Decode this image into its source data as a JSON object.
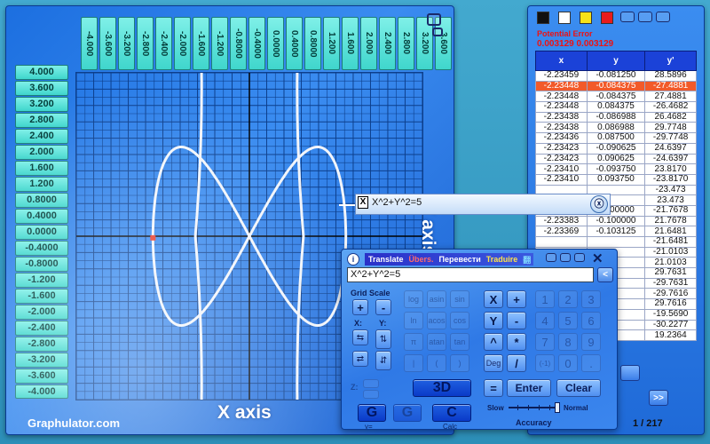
{
  "graph": {
    "x_ticks": [
      "-4.000",
      "-3.600",
      "-3.200",
      "-2.800",
      "-2.400",
      "-2.000",
      "-1.600",
      "-1.200",
      "-0.8000",
      "-0.4000",
      "0.0000",
      "0.4000",
      "0.8000",
      "1.200",
      "1.600",
      "2.000",
      "2.400",
      "2.800",
      "3.200",
      "3.600",
      "4.000"
    ],
    "y_ticks": [
      "4.000",
      "3.600",
      "3.200",
      "2.800",
      "2.400",
      "2.000",
      "1.600",
      "1.200",
      "0.8000",
      "0.4000",
      "0.0000",
      "-0.4000",
      "-0.8000",
      "-1.200",
      "-1.600",
      "-2.000",
      "-2.400",
      "-2.800",
      "-3.200",
      "-3.600",
      "-4.000"
    ],
    "x_axis_title": "X axis",
    "y_axis_title": "Y axis",
    "brand": "Graphulator.com",
    "curve_color": "#f2f5fa",
    "marker_color": "#e8392a"
  },
  "equation_bar": {
    "x_label": "X",
    "equation": "X^2+Y^2=5"
  },
  "table": {
    "swatches": [
      "#111111",
      "#ffffff",
      "#f5e21a",
      "#e81c1c"
    ],
    "error_label": "Potential Error",
    "error_value": "0.003129  0.003129",
    "headers": [
      "x",
      "y",
      "y'"
    ],
    "selected_index": 1,
    "rows": [
      [
        "-2.23459",
        "-0.081250",
        "28.5896"
      ],
      [
        "-2.23448",
        "-0.084375",
        "-27.4881"
      ],
      [
        "-2.23448",
        "-0.084375",
        "27.4881"
      ],
      [
        "-2.23448",
        "0.084375",
        "-26.4682"
      ],
      [
        "-2.23438",
        "-0.086988",
        "26.4682"
      ],
      [
        "-2.23438",
        "0.086988",
        "29.7748"
      ],
      [
        "-2.23436",
        "0.087500",
        "-29.7748"
      ],
      [
        "-2.23423",
        "-0.090625",
        "24.6397"
      ],
      [
        "-2.23423",
        "0.090625",
        "-24.6397"
      ],
      [
        "-2.23410",
        "-0.093750",
        "23.8170"
      ],
      [
        "-2.23410",
        "0.093750",
        "-23.8170"
      ],
      [
        "",
        "",
        "-23.473"
      ],
      [
        "",
        "",
        "23.473"
      ],
      [
        "-2.23383",
        "0.100000",
        "-21.7678"
      ],
      [
        "-2.23383",
        "-0.100000",
        "21.7678"
      ],
      [
        "-2.23369",
        "-0.103125",
        "21.6481"
      ],
      [
        "",
        "",
        "-21.6481"
      ],
      [
        "",
        "",
        "-21.0103"
      ],
      [
        "",
        "",
        "21.0103"
      ],
      [
        "",
        "",
        "29.7631"
      ],
      [
        "",
        "",
        "-29.7631"
      ],
      [
        "",
        "",
        "-29.7616"
      ],
      [
        "",
        "",
        "29.7616"
      ],
      [
        "",
        "",
        "-19.5690"
      ],
      [
        "",
        "",
        "-30.2277"
      ],
      [
        "",
        "",
        "19.2364"
      ]
    ],
    "row_counter": "1 / 217",
    "next_label": ">>"
  },
  "calculator": {
    "info_label": "i",
    "title_en": "Translate",
    "title_de": "Übers.",
    "title_ru": "Перевести",
    "title_fr": "Traduire",
    "title_cn": "翻",
    "display": "X^2+Y^2=5",
    "back_label": "<",
    "grid_scale": "Grid Scale",
    "x_label": "X:",
    "y_label": "Y:",
    "z_label": "Z:",
    "plus": "+",
    "minus": "-",
    "func_buttons": [
      "log",
      "asin",
      "sin",
      "ln",
      "acos",
      "cos",
      "π",
      "atan",
      "tan",
      "|",
      "(",
      ")"
    ],
    "deg_label": "Deg",
    "btn_3d": "3D",
    "x_var": "X",
    "y_var": "Y",
    "op_plus": "+",
    "op_minus": "-",
    "op_caret": "^",
    "op_times": "*",
    "op_slash": "/",
    "op_eq": "=",
    "digits": [
      "1",
      "2",
      "3",
      "4",
      "5",
      "6",
      "7",
      "8",
      "9",
      "(-1)",
      "0",
      "."
    ],
    "enter": "Enter",
    "clear": "Clear",
    "g1": "G",
    "g2": "G",
    "c": "C",
    "y_eq_label": "y=",
    "calc_label": "Calc",
    "slow": "Slow",
    "normal": "Normal",
    "accuracy": "Accuracy"
  }
}
